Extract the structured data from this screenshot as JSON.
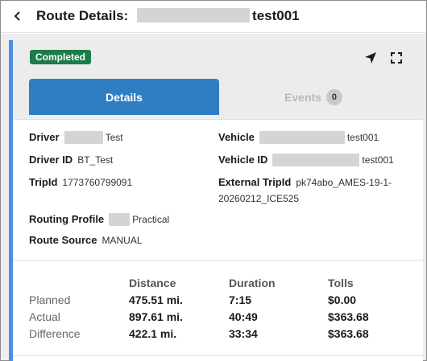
{
  "header": {
    "title_prefix": "Route Details: ",
    "title_suffix": "test001"
  },
  "card": {
    "status": "Completed",
    "tabs": [
      {
        "label": "Details",
        "active": true
      },
      {
        "label": "Events",
        "count": "0"
      }
    ]
  },
  "details": {
    "driver": {
      "label": "Driver",
      "value": "Test"
    },
    "driver_id": {
      "label": "Driver ID",
      "value": "BT_Test"
    },
    "trip_id": {
      "label": "TripId",
      "value": "1773760799091"
    },
    "routing_profile": {
      "label": "Routing Profile",
      "value": "Practical"
    },
    "route_source": {
      "label": "Route Source",
      "value": "MANUAL"
    },
    "vehicle": {
      "label": "Vehicle",
      "value": "test001"
    },
    "vehicle_id": {
      "label": "Vehicle ID",
      "value": "test001"
    },
    "external_trip_id": {
      "label": "External TripId",
      "value_line1": "pk74abo_AMES-19-1-",
      "value_line2": "20260212_ICE525"
    }
  },
  "summary": {
    "columns": [
      "Distance",
      "Duration",
      "Tolls"
    ],
    "rows": [
      {
        "label": "Planned",
        "distance": "475.51 mi.",
        "duration": "7:15",
        "tolls": "$0.00"
      },
      {
        "label": "Actual",
        "distance": "897.61 mi.",
        "duration": "40:49",
        "tolls": "$363.68"
      },
      {
        "label": "Difference",
        "distance": "422.1 mi.",
        "duration": "33:34",
        "tolls": "$363.68"
      }
    ]
  },
  "icons": {
    "back": "chevron-left-icon",
    "navigate": "navigation-arrow-icon",
    "expand": "fullscreen-icon"
  },
  "colors": {
    "accent": "#2f7ec3",
    "card_border": "#4a8fe0",
    "status_badge": "#1e7b4a"
  }
}
